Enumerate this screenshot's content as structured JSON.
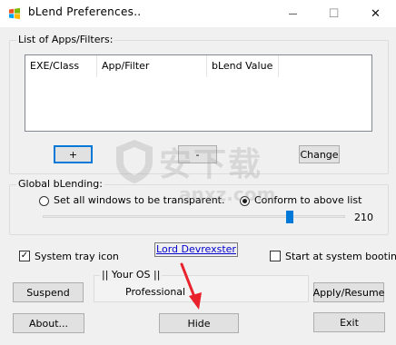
{
  "window": {
    "title": "bLend Preferences..",
    "minimize_glyph": "—",
    "maximize_glyph": "☐",
    "close_glyph": "✕"
  },
  "apps_group": {
    "label": "List of Apps/Filters:",
    "columns": [
      "EXE/Class",
      "App/Filter",
      "bLend Value"
    ],
    "rows": [],
    "add_label": "+",
    "remove_label": "-",
    "change_label": "Change"
  },
  "global_group": {
    "label": "Global bLending:",
    "option_all": "Set all windows to be transparent.",
    "option_list": "Conform to above list",
    "selected": "option_list",
    "slider_value": "210",
    "slider_min": 0,
    "slider_max": 255
  },
  "options": {
    "tray_icon_label": "System tray icon",
    "tray_icon_checked": true,
    "startup_label": "Start at system booting.",
    "startup_checked": false,
    "author_link": "Lord Devrexster"
  },
  "os_panel": {
    "label": "|| Your OS ||",
    "value": "Professional"
  },
  "buttons": {
    "suspend": "Suspend",
    "apply": "Apply/Resume",
    "about": "About...",
    "hide": "Hide",
    "exit": "Exit"
  },
  "watermark": {
    "cn_text": "安下载",
    "en_text": "anxz.com"
  },
  "colors": {
    "accent": "#0078d7",
    "link": "#0000cc",
    "annotation_arrow": "#e8212a"
  }
}
